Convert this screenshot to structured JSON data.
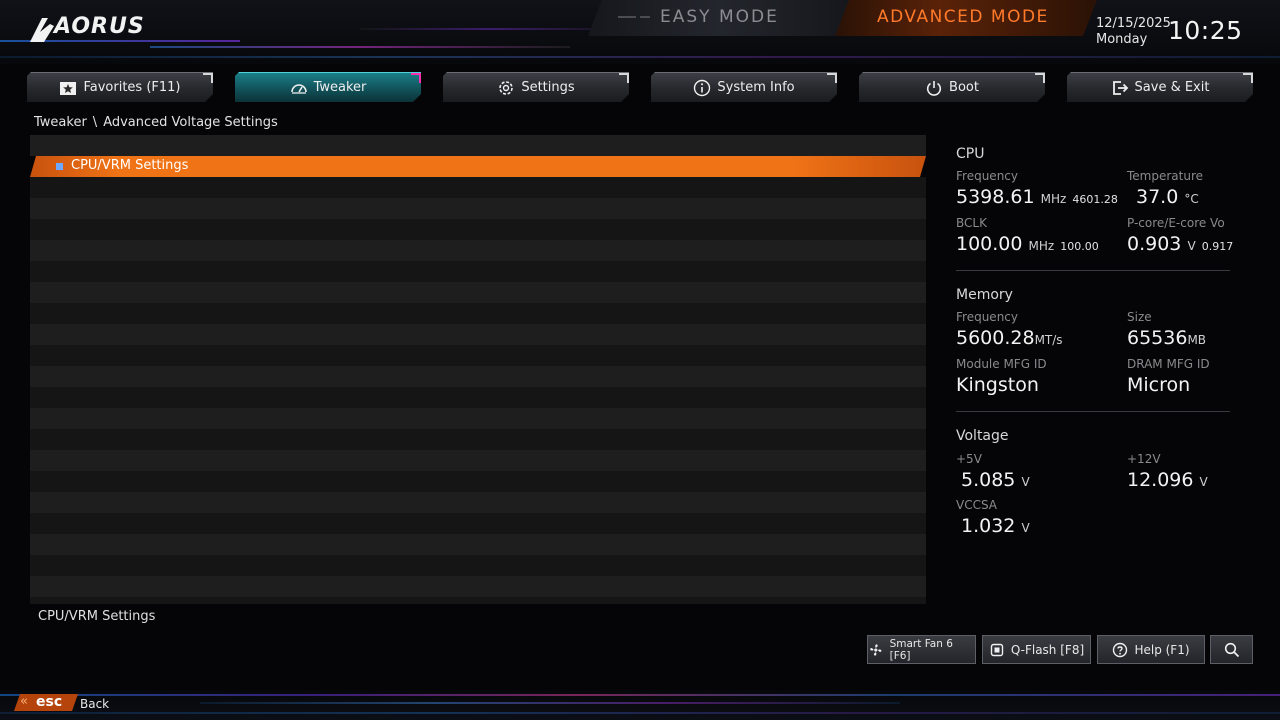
{
  "header": {
    "logo_text": "AORUS",
    "easy_mode_label": "EASY MODE",
    "advanced_mode_label": "ADVANCED MODE",
    "date": "12/15/2025",
    "weekday": "Monday",
    "time": "10:25"
  },
  "tabs": [
    {
      "label": "Favorites (F11)",
      "icon": "star-icon",
      "active": false
    },
    {
      "label": "Tweaker",
      "icon": "speedometer-icon",
      "active": true
    },
    {
      "label": "Settings",
      "icon": "gear-icon",
      "active": false
    },
    {
      "label": "System Info",
      "icon": "info-icon",
      "active": false
    },
    {
      "label": "Boot",
      "icon": "power-icon",
      "active": false
    },
    {
      "label": "Save & Exit",
      "icon": "exit-icon",
      "active": false
    }
  ],
  "breadcrumb": {
    "root": "Tweaker",
    "separator": "\\",
    "current": "Advanced Voltage Settings"
  },
  "menu": {
    "items": [
      {
        "label": "CPU/VRM Settings",
        "selected": true
      }
    ],
    "description": "CPU/VRM Settings"
  },
  "info_panel": {
    "cpu": {
      "title": "CPU",
      "frequency_label": "Frequency",
      "frequency_value": "5398.61",
      "frequency_unit": "MHz",
      "frequency_sub": "4601.28",
      "temperature_label": "Temperature",
      "temperature_value": "37.0",
      "temperature_unit": "°C",
      "bclk_label": "BCLK",
      "bclk_value": "100.00",
      "bclk_unit": "MHz",
      "bclk_sub": "100.00",
      "vcore_label": "P-core/E-core Vo",
      "vcore_value": "0.903",
      "vcore_unit": "V",
      "vcore_sub": "0.917"
    },
    "memory": {
      "title": "Memory",
      "frequency_label": "Frequency",
      "frequency_value": "5600.28",
      "frequency_unit": "MT/s",
      "size_label": "Size",
      "size_value": "65536",
      "size_unit": "MB",
      "module_label": "Module MFG ID",
      "module_value": "Kingston",
      "dram_label": "DRAM MFG ID",
      "dram_value": "Micron"
    },
    "voltage": {
      "title": "Voltage",
      "v5_label": "+5V",
      "v5_value": "5.085",
      "v12_label": "+12V",
      "v12_value": "12.096",
      "vccsa_label": "VCCSA",
      "vccsa_value": "1.032",
      "unit": "V"
    }
  },
  "footer": {
    "smart_fan_label": "Smart Fan 6 [F6]",
    "qflash_label": "Q-Flash [F8]",
    "help_label": "Help (F1)",
    "search_icon": "search-icon",
    "esc_label": "esc",
    "back_label": "Back"
  },
  "colors": {
    "accent_orange": "#f07316",
    "accent_teal": "#1a7f88",
    "accent_pink": "#ff2fb3"
  }
}
